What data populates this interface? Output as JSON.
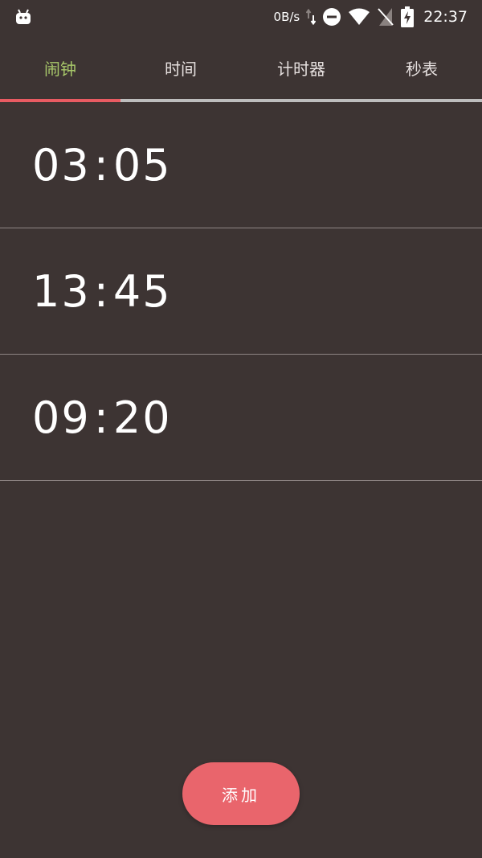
{
  "status_bar": {
    "app_icon": "android-robot-icon",
    "network_speed": "0B/s",
    "icons": [
      "data-arrows-icon",
      "do-not-disturb-icon",
      "wifi-icon",
      "no-sim-icon",
      "battery-charging-icon"
    ],
    "time": "22:37"
  },
  "tabs": [
    {
      "label": "闹钟",
      "active": true
    },
    {
      "label": "时间",
      "active": false
    },
    {
      "label": "计时器",
      "active": false
    },
    {
      "label": "秒表",
      "active": false
    }
  ],
  "colors": {
    "background": "#3d3433",
    "active_tab": "#a8c86a",
    "indicator": "#e85b62",
    "accent_button": "#e9656c"
  },
  "alarms": [
    {
      "hours": "03",
      "minutes": "05"
    },
    {
      "hours": "13",
      "minutes": "45"
    },
    {
      "hours": "09",
      "minutes": "20"
    }
  ],
  "add_button": {
    "label": "添加"
  }
}
